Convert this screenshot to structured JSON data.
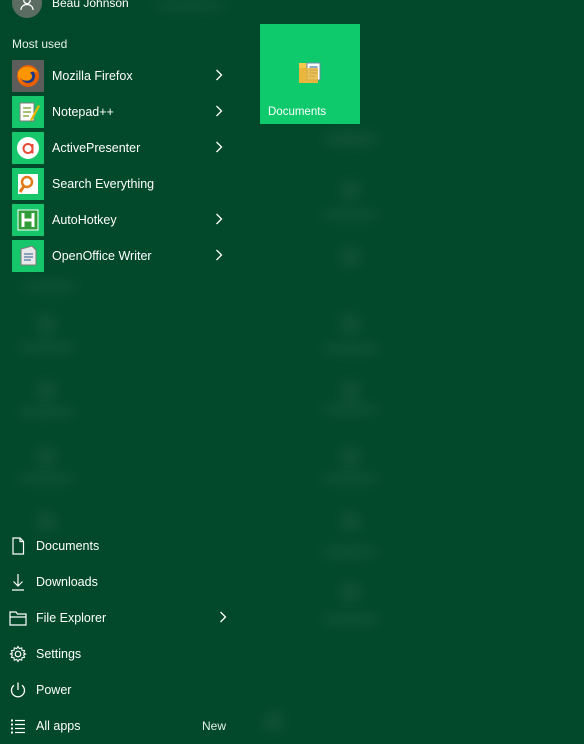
{
  "user": {
    "name": "Beau Johnson"
  },
  "most_used": {
    "label": "Most used",
    "items": [
      {
        "label": "Mozilla Firefox",
        "icon": "firefox-icon",
        "has_submenu": true
      },
      {
        "label": "Notepad++",
        "icon": "notepad-plus-plus-icon",
        "has_submenu": true
      },
      {
        "label": "ActivePresenter",
        "icon": "activepresenter-icon",
        "has_submenu": true
      },
      {
        "label": "Search Everything",
        "icon": "search-everything-icon",
        "has_submenu": false
      },
      {
        "label": "AutoHotkey",
        "icon": "autohotkey-icon",
        "has_submenu": true
      },
      {
        "label": "OpenOffice Writer",
        "icon": "openoffice-writer-icon",
        "has_submenu": true
      }
    ]
  },
  "bottom": {
    "items": [
      {
        "label": "Documents",
        "icon": "document-icon"
      },
      {
        "label": "Downloads",
        "icon": "download-icon"
      },
      {
        "label": "File Explorer",
        "icon": "folder-icon",
        "has_submenu": true
      },
      {
        "label": "Settings",
        "icon": "gear-icon"
      },
      {
        "label": "Power",
        "icon": "power-icon"
      },
      {
        "label": "All apps",
        "icon": "list-icon",
        "badge": "New"
      }
    ]
  },
  "tiles": [
    {
      "label": "Documents",
      "icon": "documents-folder-icon",
      "color": "#0fca6c"
    }
  ],
  "colors": {
    "background": "#02482a",
    "tile": "#0fca6c"
  }
}
